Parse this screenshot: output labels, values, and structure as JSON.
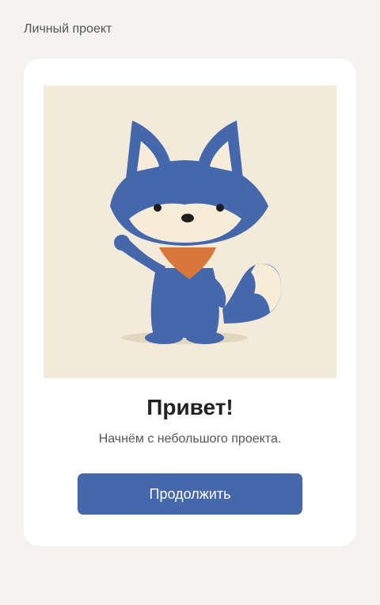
{
  "header": {
    "breadcrumb": "Личный проект"
  },
  "card": {
    "title": "Привет!",
    "subtitle": "Начнём с небольшого проекта.",
    "continue_label": "Продолжить"
  },
  "colors": {
    "page_bg": "#f4f3ef",
    "card_bg": "#ffffff",
    "illustration_bg": "#f3ead9",
    "fox_blue": "#4567ac",
    "fox_cream": "#f6ecd8",
    "bandana": "#d9773a",
    "button_bg": "#4567ac"
  },
  "icons": {
    "mascot": "fox-mascot-icon"
  }
}
